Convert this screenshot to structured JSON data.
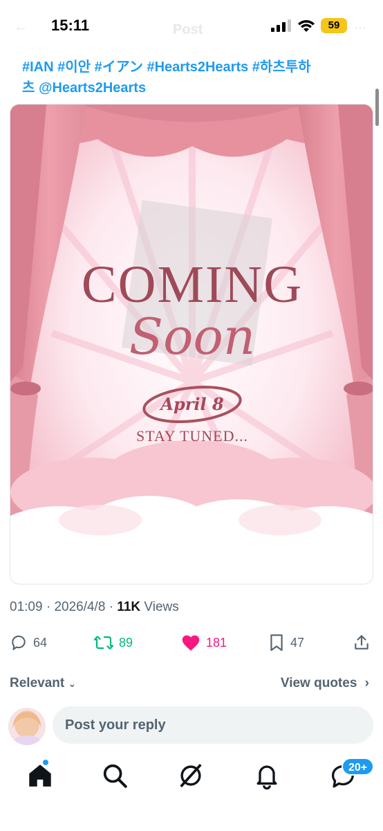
{
  "status_bar": {
    "time": "15:11",
    "battery": "59",
    "header_title": "Post"
  },
  "tweet": {
    "segments": [
      "#IAN",
      "#이안",
      "#イアン",
      "#Hearts2Hearts",
      "#하츠투하츠",
      "@Hearts2Hearts"
    ],
    "line1": "#IAN #이안 #イアン #Hearts2Hearts #하츠투하",
    "line2": "츠 @Hearts2Hearts"
  },
  "media": {
    "headline": "COMING",
    "subline": "Soon",
    "date": "April 8",
    "tagline": "STAY TUNED..."
  },
  "meta": {
    "time": "01:09",
    "date": "2026/4/8",
    "views_count": "11K",
    "views_label": "Views"
  },
  "actions": {
    "replies": "64",
    "reposts": "89",
    "likes": "181",
    "bookmarks": "47"
  },
  "colors": {
    "accent": "#1d9bf0",
    "repost": "#00ba7c",
    "like": "#f91880",
    "muted": "#536471"
  },
  "sort": {
    "label": "Relevant",
    "view_quotes": "View quotes"
  },
  "reply": {
    "placeholder": "Post your reply"
  },
  "nav": {
    "items": [
      "home-icon",
      "search-icon",
      "grok-icon",
      "notifications-icon",
      "messages-icon"
    ],
    "messages_badge": "20+"
  }
}
